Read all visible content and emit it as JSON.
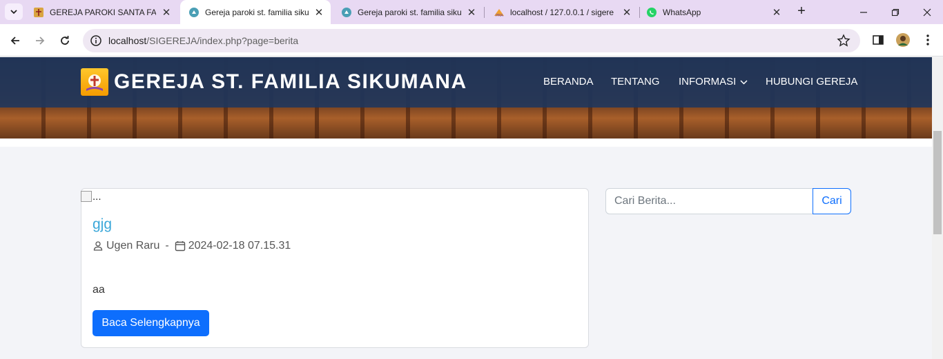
{
  "browser": {
    "tabs": [
      {
        "title": "GEREJA PAROKI SANTA FAMI",
        "active": false,
        "icon": "church-logo-icon"
      },
      {
        "title": "Gereja paroki st. familia sikur",
        "active": true,
        "icon": "globe-icon"
      },
      {
        "title": "Gereja paroki st. familia siku",
        "active": false,
        "icon": "globe-icon"
      },
      {
        "title": "localhost / 127.0.0.1 / sigere",
        "active": false,
        "icon": "phpmyadmin-icon"
      },
      {
        "title": "WhatsApp",
        "active": false,
        "icon": "whatsapp-icon"
      }
    ],
    "url_host": "localhost",
    "url_path": "/SIGEREJA/index.php?page=berita"
  },
  "site": {
    "brand": "GEREJA ST. FAMILIA SIKUMANA",
    "nav": [
      "BERANDA",
      "TENTANG",
      "INFORMASI",
      "HUBUNGI GEREJA"
    ]
  },
  "post": {
    "image_alt": "...",
    "title": "gjg",
    "author": "Ugen Raru",
    "separator": "-",
    "date": "2024-02-18 07.15.31",
    "excerpt": "aa",
    "read_more": "Baca Selengkapnya"
  },
  "search": {
    "placeholder": "Cari Berita...",
    "button": "Cari"
  },
  "colors": {
    "primary": "#0d6efd",
    "title_link": "#3ba7d9",
    "header_overlay": "#1e375f"
  }
}
